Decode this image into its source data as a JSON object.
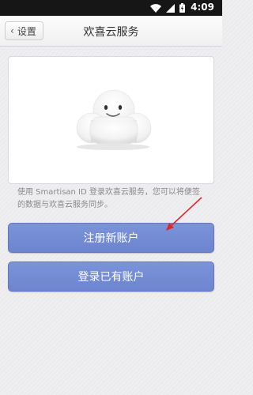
{
  "status_bar": {
    "time": "4:09",
    "icons": [
      "wifi-icon",
      "signal-icon",
      "battery-icon"
    ]
  },
  "header": {
    "back_label": "设置",
    "title": "欢喜云服务"
  },
  "description": "使用 Smartisan ID 登录欢喜云服务，您可以将便签的数据与欢喜云服务同步。",
  "buttons": {
    "register": "注册新账户",
    "login": "登录已有账户"
  },
  "colors": {
    "button": "#7088d2",
    "arrow": "#e0262a"
  }
}
